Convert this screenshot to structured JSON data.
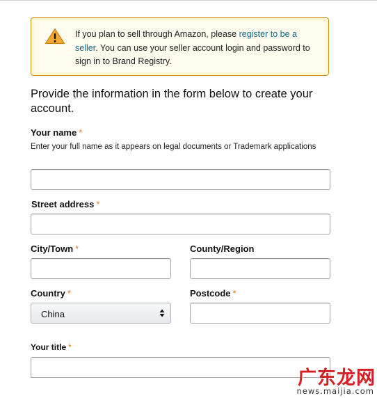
{
  "alert": {
    "icon": "warning-icon",
    "text_before": "If you plan to sell through Amazon, please ",
    "link": "register to be a seller",
    "text_after": ". You can use your seller account login and password to sign in to Brand Registry."
  },
  "intro": "Provide the information in the form below to create your account.",
  "required_mark": "*",
  "fields": {
    "your_name": {
      "label": "Your name",
      "help": "Enter your full name as it appears on legal documents or Trademark applications",
      "value": ""
    },
    "street_address": {
      "label": "Street address",
      "value": ""
    },
    "city": {
      "label": "City/Town",
      "value": ""
    },
    "county": {
      "label": "County/Region",
      "value": ""
    },
    "country": {
      "label": "Country",
      "value": "China"
    },
    "postcode": {
      "label": "Postcode",
      "value": ""
    },
    "your_title": {
      "label": "Your title",
      "value": ""
    }
  },
  "watermark": {
    "title": "广东龙网",
    "url": "news.maijia.com"
  },
  "colors": {
    "required": "#e07a1f",
    "link": "#0e6a8a",
    "alert_border": "#c89411",
    "watermark": "#d41f24"
  }
}
